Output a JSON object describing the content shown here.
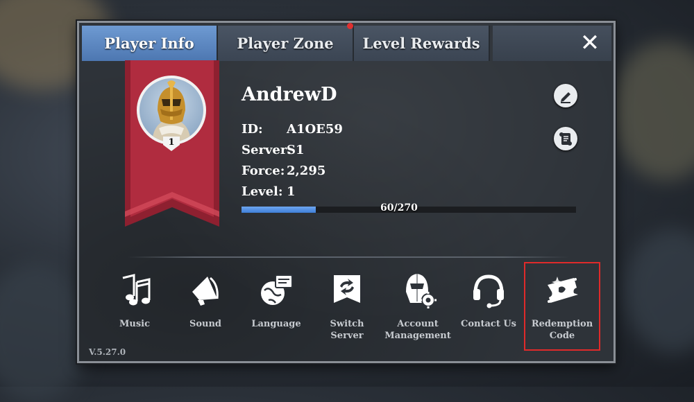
{
  "tabs": [
    "Player Info",
    "Player Zone",
    "Level Rewards"
  ],
  "active_tab": "Player Info",
  "close_icon": "close-icon",
  "player": {
    "name": "AndrewD",
    "avatar_level": "1",
    "id_label": "ID:",
    "id_value": "A1OE59",
    "server_label": "Server:",
    "server_value": "S1",
    "force_label": "Force:",
    "force_value": "2,295",
    "level_label": "Level:",
    "level_value": "1",
    "xp_text": "60/270",
    "xp_fraction": 0.222
  },
  "side_buttons": [
    "edit-name-icon",
    "scroll-profile-icon"
  ],
  "options": [
    {
      "label": "Music",
      "icon": "music-notes-icon"
    },
    {
      "label": "Sound",
      "icon": "speaker-icon"
    },
    {
      "label": "Language",
      "icon": "globe-language-icon"
    },
    {
      "label": "Switch Server",
      "icon": "switch-server-icon"
    },
    {
      "label": "Account Management",
      "icon": "account-helmet-gear-icon"
    },
    {
      "label": "Contact Us",
      "icon": "headset-icon"
    },
    {
      "label": "Redemption Code",
      "icon": "ticket-icon"
    }
  ],
  "version": "V.5.27.0",
  "colors": {
    "active_tab": "#5d88c2",
    "banner": "#a8283a",
    "xp_fill": "#4f8fe6",
    "highlight": "#e02a2a"
  }
}
